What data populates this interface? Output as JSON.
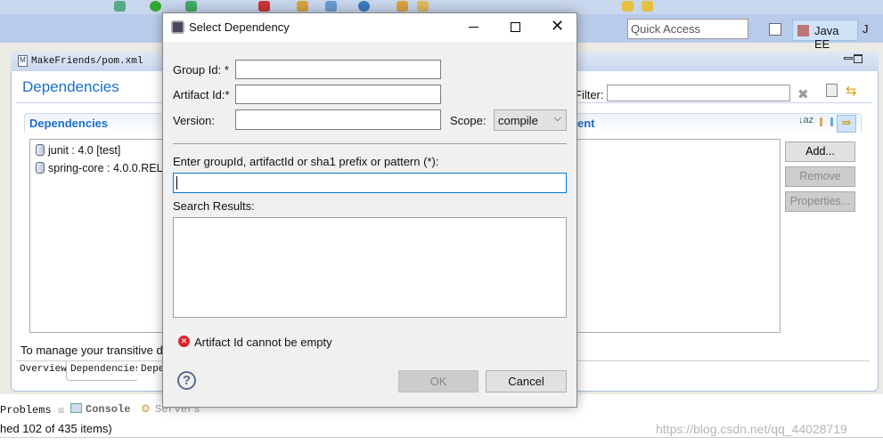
{
  "workbench": {
    "quick_access_placeholder": "Quick Access",
    "perspective": "Java EE",
    "perspective2": "J"
  },
  "editor": {
    "tab": "MakeFriends/pom.xml",
    "page_title": "Dependencies",
    "filter_label": "Filter:",
    "section_title": "Dependencies",
    "section_title_right": "ent",
    "dependencies": [
      "junit : 4.0 [test]",
      "spring-core : 4.0.0.REL"
    ],
    "buttons": {
      "add": "Add...",
      "remove": "Remove",
      "properties": "Properties..."
    },
    "hint": "To manage your transitive d",
    "bottom_tabs": [
      "Overview",
      "Dependencies",
      "Depe"
    ]
  },
  "panel": {
    "tabs": [
      "Problems",
      "Console",
      "Servers"
    ],
    "status": "hed 102 of 435 items)"
  },
  "dialog": {
    "title": "Select Dependency",
    "group_label": "Group Id:",
    "artifact_label": "Artifact Id:",
    "required_mark": "*",
    "version_label": "Version:",
    "scope_label": "Scope:",
    "scope_value": "compile",
    "group_value": "",
    "artifact_value": "",
    "version_value": "",
    "search_label": "Enter groupId, artifactId or sha1 prefix or pattern (*):",
    "search_value": "",
    "results_label": "Search Results:",
    "error": "Artifact Id cannot be empty",
    "ok": "OK",
    "cancel": "Cancel",
    "error_color": "#d9262c"
  },
  "watermark": "https://blog.csdn.net/qq_44028719"
}
